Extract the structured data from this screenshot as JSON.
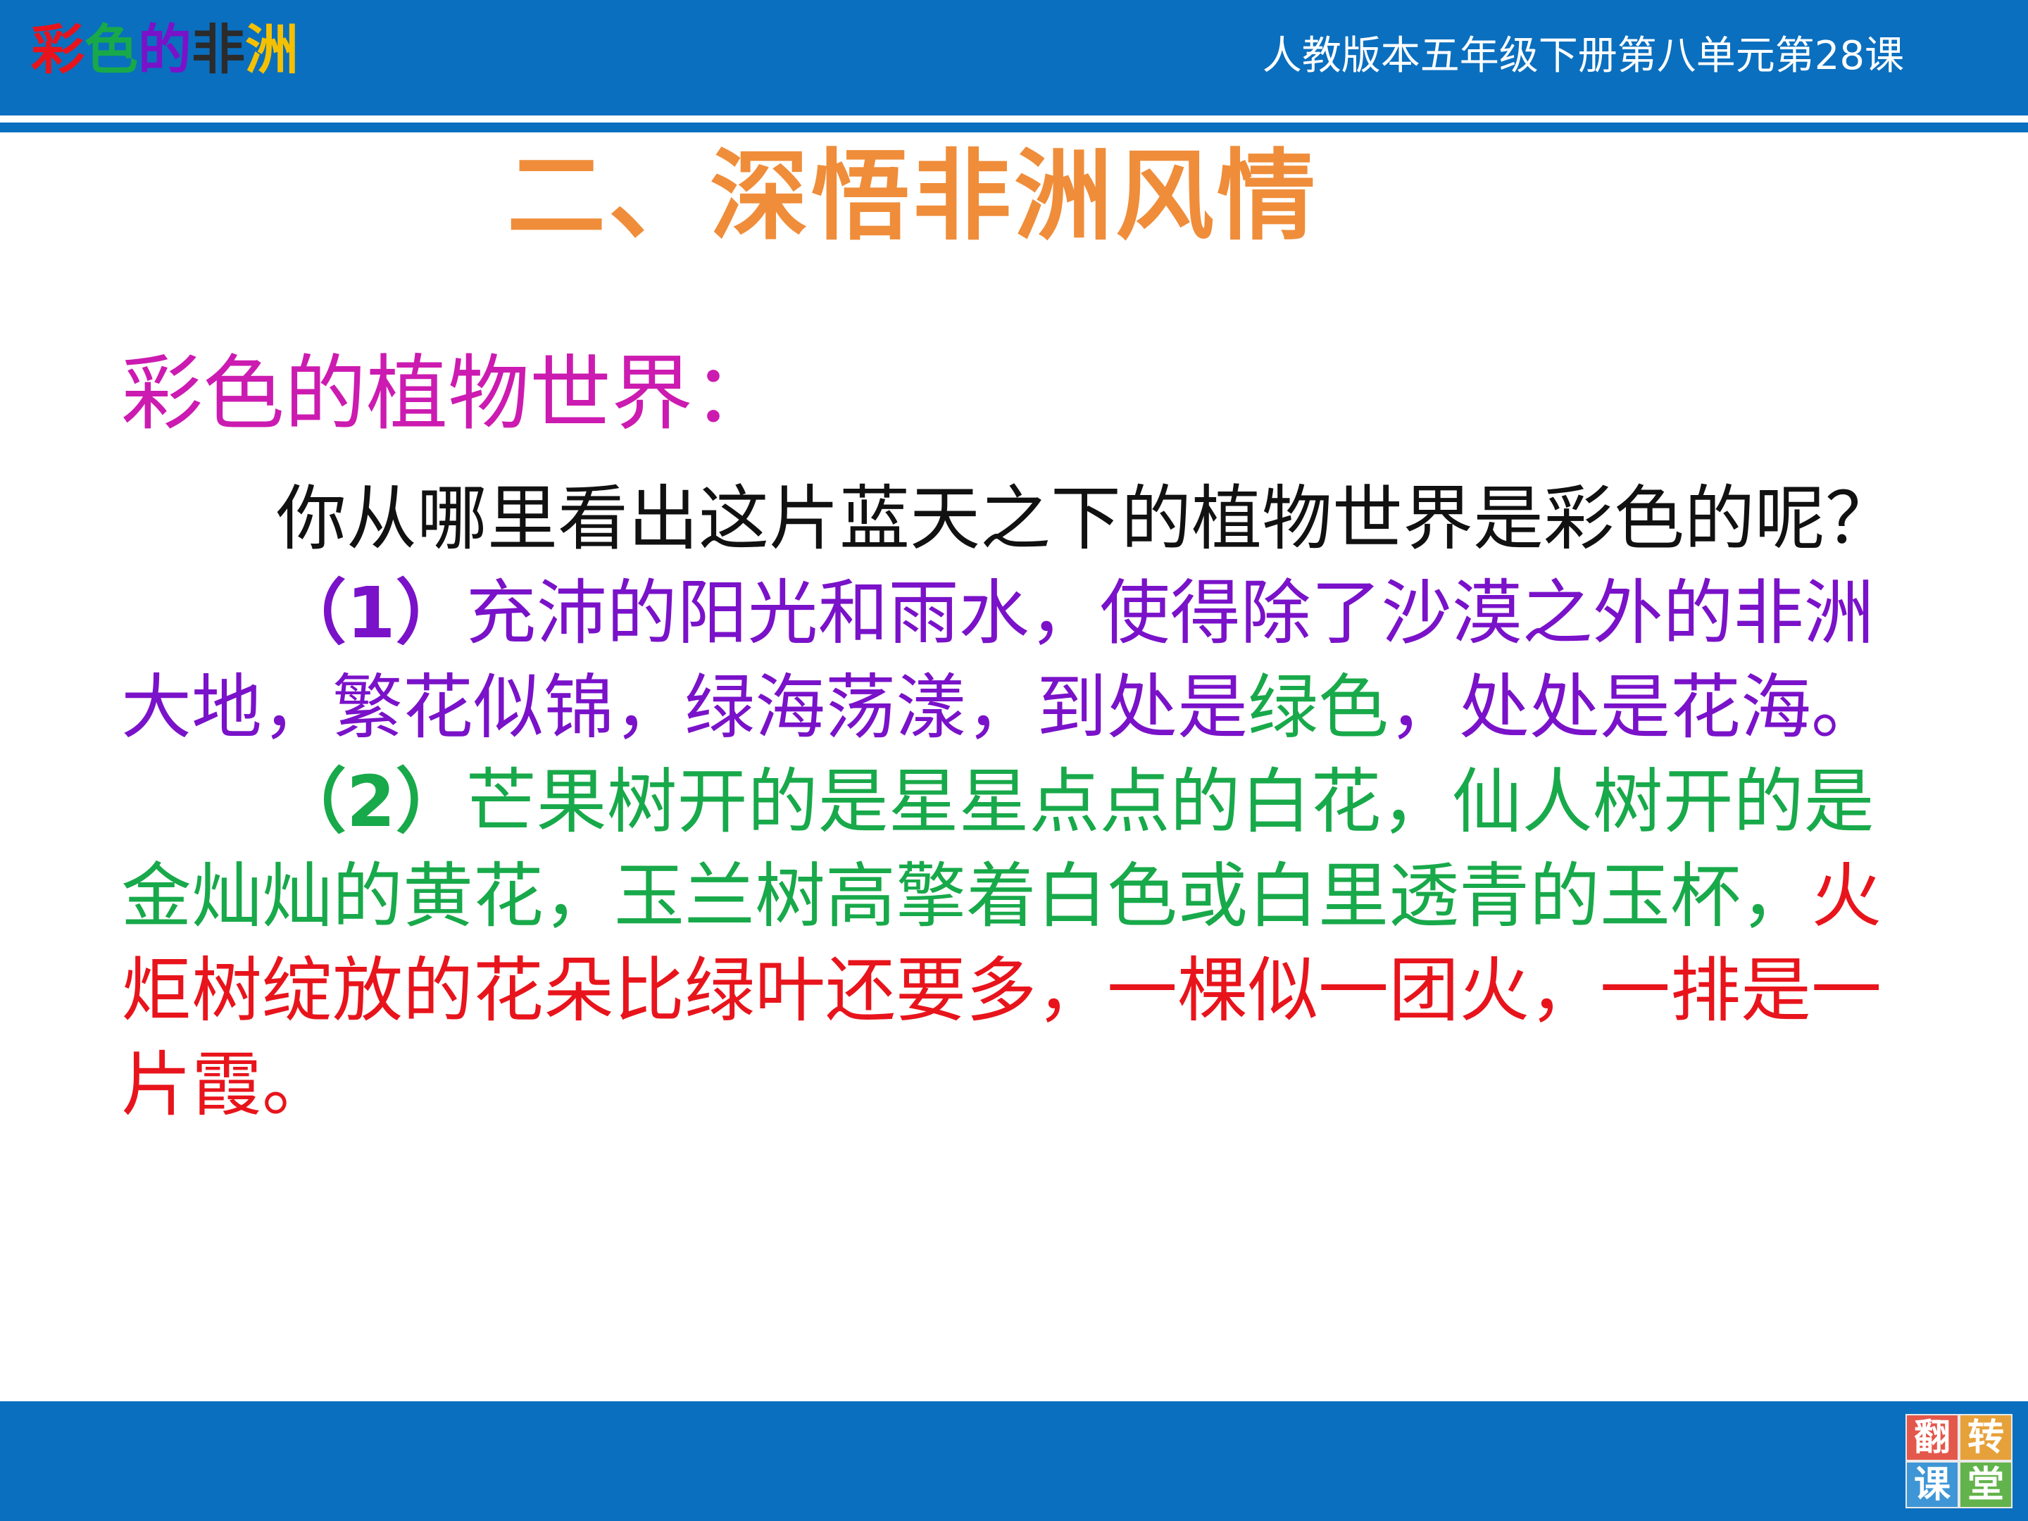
{
  "header": {
    "brand_chars": [
      {
        "char": "彩",
        "color": "#e8141c"
      },
      {
        "char": "色",
        "color": "#18a94a"
      },
      {
        "char": "的",
        "color": "#7a12c9"
      },
      {
        "char": "非",
        "color": "#2b2b2b"
      },
      {
        "char": "洲",
        "color": "#f4c000"
      }
    ],
    "lesson_text": "人教版本五年级下册第八单元第28课"
  },
  "section_title": "二、深悟非洲风情",
  "subtitle": "彩色的植物世界：",
  "question": "你从哪里看出这片蓝天之下的植物世界是彩色的呢？",
  "answer1": {
    "number": "（1）",
    "text_before": "充沛的阳光和雨水，使得除了沙漠之外的非洲大地，繁花似锦，绿海荡漾，到处是",
    "highlight": "绿色",
    "text_after": "，处处是花海。"
  },
  "answer2": {
    "number": "（2）",
    "green_text": "芒果树开的是星星点点的白花，仙人树开的是金灿灿的黄花，玉兰树高擎着白色或白里透青的玉杯，",
    "red_text": "火炬树绽放的花朵比绿叶还要多，一棵似一团火，一排是一片霞。"
  },
  "footer_badge": [
    "翻",
    "转",
    "课",
    "堂"
  ],
  "colors": {
    "header_blue": "#0a6fbf",
    "title_orange": "#ef8d3a",
    "subtitle_magenta": "#cc1bb0",
    "purple": "#7a12c9",
    "green": "#18a94a",
    "red": "#e8141c"
  }
}
